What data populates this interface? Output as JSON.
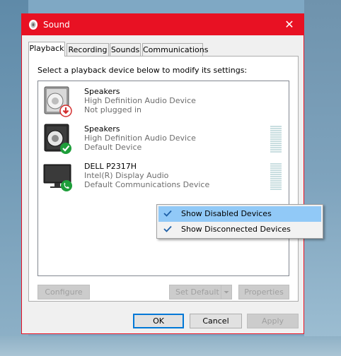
{
  "window": {
    "title": "Sound",
    "close_glyph": "✕"
  },
  "tabs": [
    {
      "label": "Playback",
      "active": true
    },
    {
      "label": "Recording",
      "active": false
    },
    {
      "label": "Sounds",
      "active": false
    },
    {
      "label": "Communications",
      "active": false
    }
  ],
  "instruction": "Select a playback device below to modify its settings:",
  "devices": [
    {
      "name": "Speakers",
      "description": "High Definition Audio Device",
      "status": "Not plugged in",
      "icon": "speaker-icon",
      "badge": "unplugged-arrow-icon",
      "badge_color": "#d32f2f"
    },
    {
      "name": "Speakers",
      "description": "High Definition Audio Device",
      "status": "Default Device",
      "icon": "speaker-icon",
      "badge": "checkmark-icon",
      "badge_color": "#1e9e3a"
    },
    {
      "name": "DELL P2317H",
      "description": "Intel(R) Display Audio",
      "status": "Default Communications Device",
      "icon": "monitor-icon",
      "badge": "phone-icon",
      "badge_color": "#1e9e3a"
    }
  ],
  "context_menu": {
    "items": [
      {
        "label": "Show Disabled Devices",
        "checked": true,
        "highlighted": true
      },
      {
        "label": "Show Disconnected Devices",
        "checked": true,
        "highlighted": false
      }
    ]
  },
  "panel_buttons": {
    "configure": "Configure",
    "set_default": "Set Default",
    "properties": "Properties"
  },
  "dialog_buttons": {
    "ok": "OK",
    "cancel": "Cancel",
    "apply": "Apply"
  },
  "colors": {
    "title_bar": "#e81123",
    "highlight": "#91c9f7",
    "accent": "#0078d7"
  }
}
